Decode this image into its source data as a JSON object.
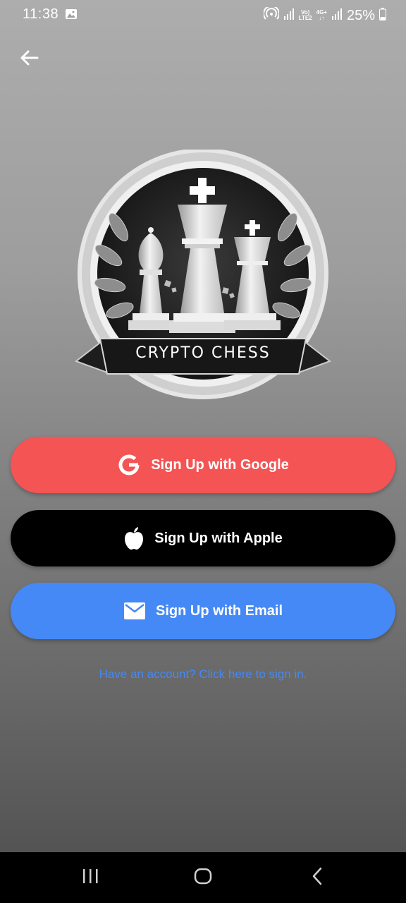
{
  "status_bar": {
    "time": "11:38",
    "battery": "25%",
    "network_volte": "Vo)",
    "network_lte": "LTE2",
    "network_4g": "4G+",
    "icons": [
      "gallery-icon",
      "hotspot-icon",
      "signal-icon",
      "volte-icon",
      "data-icon",
      "battery-icon"
    ]
  },
  "header": {
    "back_icon": "arrow-left-icon"
  },
  "logo": {
    "text": "CRYPTO CHESS"
  },
  "buttons": {
    "google": {
      "label": "Sign Up with Google",
      "icon": "google-icon",
      "color": "#f45454"
    },
    "apple": {
      "label": "Sign Up with Apple",
      "icon": "apple-icon",
      "color": "#000000"
    },
    "email": {
      "label": "Sign Up with Email",
      "icon": "mail-icon",
      "color": "#4589f6"
    }
  },
  "signin_link": "Have an account? Click here to sign in.",
  "nav_bar": {
    "icons": [
      "recents-icon",
      "home-icon",
      "back-icon"
    ]
  }
}
